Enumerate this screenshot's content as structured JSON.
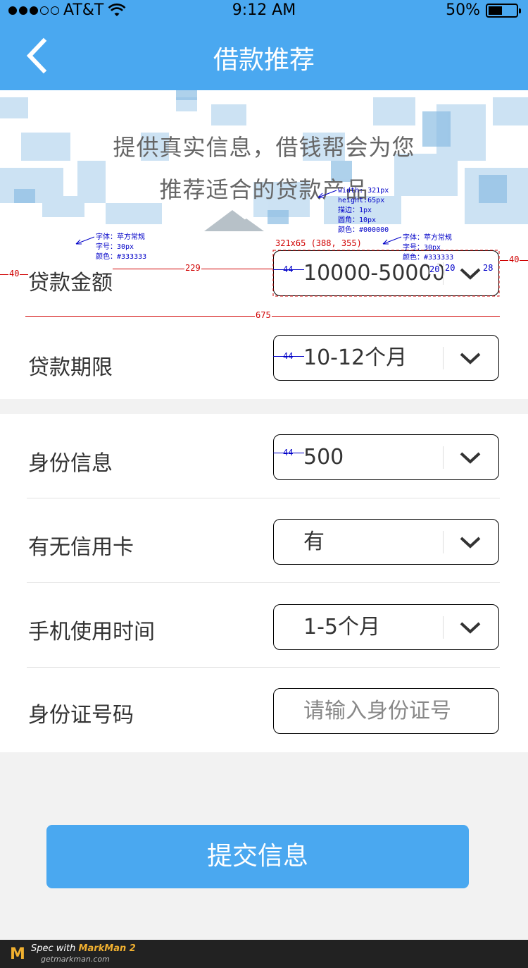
{
  "status_bar": {
    "carrier": "AT&T",
    "time": "9:12 AM",
    "battery_text": "50%",
    "battery_level": 0.5,
    "signal_dots_filled": 3,
    "signal_dots_total": 5
  },
  "nav": {
    "title": "借款推荐",
    "back_icon": "chevron-left-icon"
  },
  "banner": {
    "line1": "提供真实信息，借钱帮会为您",
    "line2": "推荐适合的贷款产品"
  },
  "form": {
    "section1": [
      {
        "label": "贷款金额",
        "value": "10000-50000"
      },
      {
        "label": "贷款期限",
        "value": "10-12个月"
      }
    ],
    "section2": [
      {
        "label": "身份信息",
        "value": "500"
      },
      {
        "label": "有无信用卡",
        "value": "有"
      },
      {
        "label": "手机使用时间",
        "value": "1-5个月"
      },
      {
        "label": "身份证号码",
        "placeholder": "请输入身份证号"
      }
    ]
  },
  "submit_label": "提交信息",
  "annotations": {
    "label_spec": [
      "字体：苹方常规",
      "字号：30px",
      "颜色：#333333"
    ],
    "value_spec": [
      "字体：苹方常规",
      "字号：30px",
      "颜色：#333333"
    ],
    "box_spec": [
      "width: 321px",
      "height:65px",
      "描边：1px",
      "圆角：10px",
      "颜色：#000000"
    ],
    "box_size": "321x65 (388, 355)",
    "dim_40_left": "40",
    "dim_229": "229",
    "dim_44": "44",
    "dim_20a": "20",
    "dim_20b": "20",
    "dim_28": "28",
    "dim_40_right": "40",
    "dim_675": "675"
  },
  "footer": {
    "spec_prefix": "Spec with",
    "app_name": "MarkMan 2",
    "url": "getmarkman.com",
    "logo_letter": "M"
  },
  "colors": {
    "primary": "#4aa8f0",
    "label": "#333333",
    "border": "#000000",
    "annotation_blue": "#0000c8",
    "annotation_red": "#d00000"
  }
}
